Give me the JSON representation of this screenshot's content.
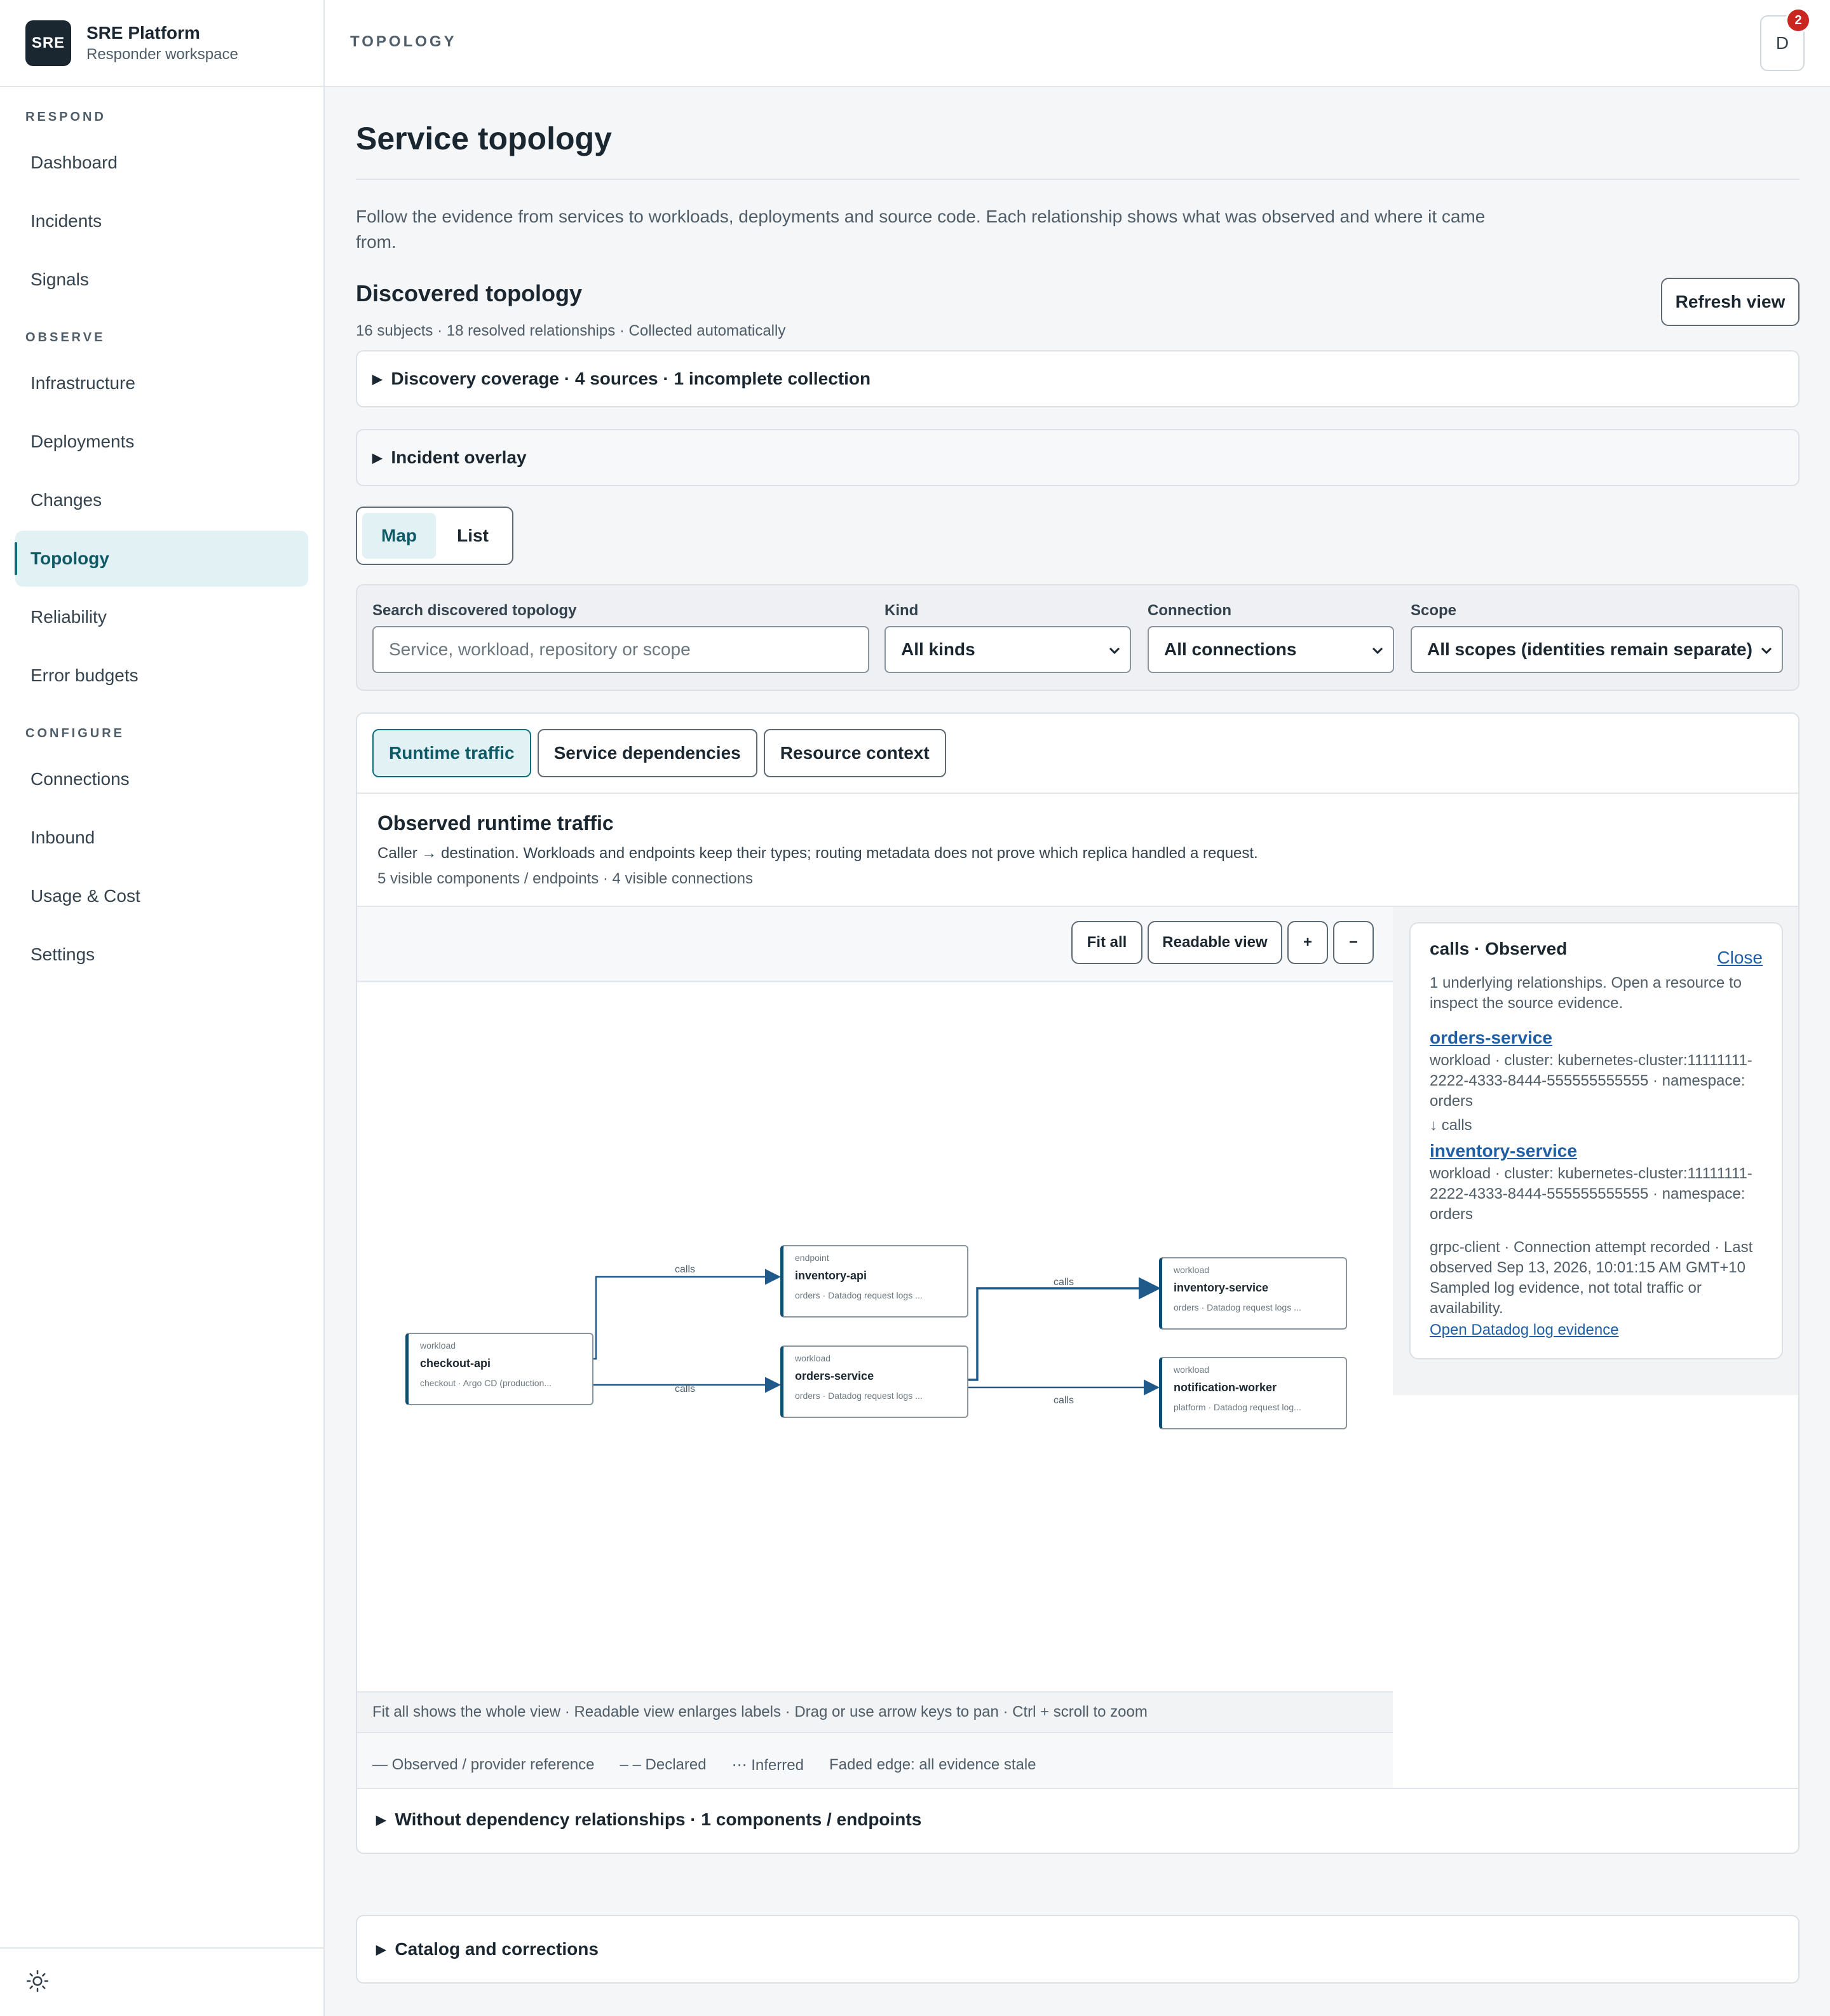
{
  "brand": {
    "logo": "SRE",
    "name": "SRE Platform",
    "subtitle": "Responder workspace"
  },
  "sidebar": {
    "sections": [
      {
        "label": "RESPOND",
        "items": [
          "Dashboard",
          "Incidents",
          "Signals"
        ]
      },
      {
        "label": "OBSERVE",
        "items": [
          "Infrastructure",
          "Deployments",
          "Changes",
          "Topology",
          "Reliability",
          "Error budgets"
        ]
      },
      {
        "label": "CONFIGURE",
        "items": [
          "Connections",
          "Inbound",
          "Usage & Cost",
          "Settings"
        ]
      }
    ],
    "active_item": "Topology",
    "theme_icon": "sun-icon"
  },
  "topbar": {
    "breadcrumb": "TOPOLOGY",
    "avatar_initial": "D",
    "notification_count": "2"
  },
  "page": {
    "title": "Service topology",
    "intro": "Follow the evidence from services to workloads, deployments and source code. Each relationship shows what was observed and where it came from.",
    "discovered_title": "Discovered topology",
    "discovered_sub": "16 subjects · 18 resolved relationships · Collected automatically",
    "refresh_label": "Refresh view",
    "coverage_label": "Discovery coverage · 4 sources · 1 incomplete collection",
    "overlay_label": "Incident overlay",
    "view_toggle": {
      "map": "Map",
      "list": "List",
      "selected": "Map"
    }
  },
  "filters": {
    "search_label": "Search discovered topology",
    "search_placeholder": "Service, workload, repository or scope",
    "kind_label": "Kind",
    "kind_value": "All kinds",
    "connection_label": "Connection",
    "connection_value": "All connections",
    "scope_label": "Scope",
    "scope_value": "All scopes (identities remain separate)"
  },
  "panel": {
    "tabs": [
      "Runtime traffic",
      "Service dependencies",
      "Resource context"
    ],
    "active_tab": "Runtime traffic",
    "title": "Observed runtime traffic",
    "subtitle": "Caller → destination. Workloads and endpoints keep their types; routing metadata does not prove which replica handled a request.",
    "counts": "5 visible components / endpoints · 4 visible connections",
    "tools": {
      "fit": "Fit all",
      "readable": "Readable view",
      "zoom_in": "+",
      "zoom_out": "−"
    },
    "hint": "Fit all shows the whole view · Readable view enlarges labels · Drag or use arrow keys to pan · Ctrl + scroll to zoom",
    "legend": [
      "— Observed / provider reference",
      "– – Declared",
      "⋯ Inferred",
      "Faded edge: all evidence stale"
    ],
    "without_label": "Without dependency relationships · 1 components / endpoints"
  },
  "graph": {
    "nodes": [
      {
        "kind": "workload",
        "name": "checkout-api",
        "meta": "checkout · Argo CD (production..."
      },
      {
        "kind": "endpoint",
        "name": "inventory-api",
        "meta": "orders · Datadog request logs ..."
      },
      {
        "kind": "workload",
        "name": "orders-service",
        "meta": "orders · Datadog request logs ..."
      },
      {
        "kind": "workload",
        "name": "inventory-service",
        "meta": "orders · Datadog request logs ..."
      },
      {
        "kind": "workload",
        "name": "notification-worker",
        "meta": "platform · Datadog request log..."
      }
    ],
    "edge_label": "calls"
  },
  "detail": {
    "title": "calls · Observed",
    "close": "Close",
    "intro": "1 underlying relationships. Open a resource to inspect the source evidence.",
    "source_link": "orders-service",
    "source_meta": "workload · cluster: kubernetes-cluster:11111111-2222-4333-8444-555555555555 · namespace: orders",
    "arrow": "↓ calls",
    "target_link": "inventory-service",
    "target_meta": "workload · cluster: kubernetes-cluster:11111111-2222-4333-8444-555555555555 · namespace: orders",
    "evidence": "grpc-client · Connection attempt recorded · Last observed Sep 13, 2026, 10:01:15 AM GMT+10 Sampled log evidence, not total traffic or availability.",
    "evidence_link": "Open Datadog log evidence"
  },
  "catalog_label": "Catalog and corrections",
  "colors": {
    "accent": "#0e6e7a",
    "accent_bg": "#e1f1f4",
    "link": "#1f5fa8",
    "badge": "#c8261f",
    "edge": "#1f5a8a"
  }
}
